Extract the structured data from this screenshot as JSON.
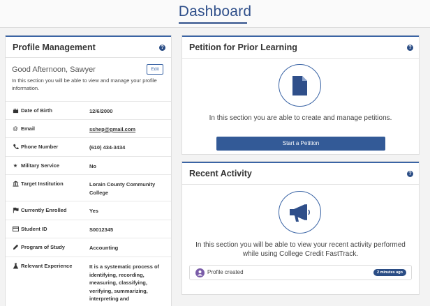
{
  "header": {
    "title": "Dashboard"
  },
  "profile": {
    "title": "Profile Management",
    "greeting": "Good Afternoon, Sawyer",
    "edit_label": "Edit",
    "intro": "In this section you will be able to view and manage your profile information.",
    "rows": [
      {
        "icon": "birthday-cake-icon",
        "label": "Date of Birth",
        "value": "12/6/2000"
      },
      {
        "icon": "at-sign-icon",
        "label": "Email",
        "value": "sshep@gmail.com"
      },
      {
        "icon": "phone-icon",
        "label": "Phone Number",
        "value": "(610) 434-3434"
      },
      {
        "icon": "star-icon",
        "label": "Military Service",
        "value": "No"
      },
      {
        "icon": "institution-icon",
        "label": "Target Institution",
        "value": "Lorain County Community College"
      },
      {
        "icon": "flag-icon",
        "label": "Currently Enrolled",
        "value": "Yes"
      },
      {
        "icon": "id-card-icon",
        "label": "Student ID",
        "value": "S0012345"
      },
      {
        "icon": "pencil-icon",
        "label": "Program of Study",
        "value": "Accounting"
      },
      {
        "icon": "flask-icon",
        "label": "Relevant Experience",
        "value": "It is a systematic process of identifying, recording, measuring, classifying, verifying, summarizing, interpreting and"
      }
    ]
  },
  "petition": {
    "title": "Petition for Prior Learning",
    "icon": "document-icon",
    "description": "In this section you are able to create and manage petitions.",
    "button_label": "Start a Petition"
  },
  "activity": {
    "title": "Recent Activity",
    "icon": "megaphone-icon",
    "description": "In this section you will be able to view your recent activity performed while using College Credit FastTrack.",
    "items": [
      {
        "text": "Profile created",
        "time": "2 minutes ago"
      }
    ]
  },
  "help_symbol": "?",
  "colors": {
    "primary": "#335a97",
    "accent": "#3a64a5",
    "badge": "#2b4d85"
  }
}
